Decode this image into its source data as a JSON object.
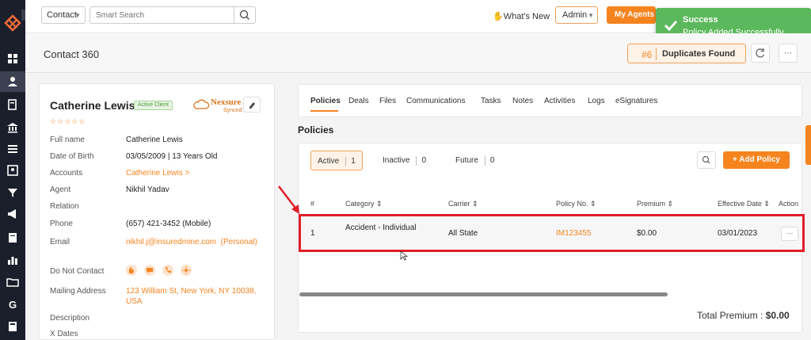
{
  "topbar": {
    "contact_select": "Contact",
    "search_placeholder": "Smart Search",
    "whats_new": "What's New",
    "admin_select": "Admin",
    "my_agents": "My Agents"
  },
  "toast": {
    "title": "Success",
    "message": "Policy Added Successfully."
  },
  "header": {
    "title": "Contact 360",
    "duplicates_count": "#6",
    "duplicates_label": "Duplicates Found",
    "more": "···"
  },
  "contact": {
    "name": "Catherine Lewis",
    "badge": "Active Client",
    "stars": "☆☆☆☆☆",
    "integration_name": "Nexsure",
    "integration_status": "Synced",
    "fields": {
      "full_name_label": "Full name",
      "full_name": "Catherine Lewis",
      "dob_label": "Date of Birth",
      "dob": "03/05/2009",
      "age": "13 Years Old",
      "accounts_label": "Accounts",
      "accounts": "Catherine Lewis >",
      "agent_label": "Agent",
      "agent": "Nikhil Yadav",
      "relation_label": "Relation",
      "phone_label": "Phone",
      "phone": "(657) 421-3452 (Mobile)",
      "email_label": "Email",
      "email": "nikhil.j@insuredmine.com",
      "email_type": "(Personal)",
      "dnc_label": "Do Not Contact",
      "mailing_label": "Mailing Address",
      "mailing_line1": "123 William St, New York, NY 10038,",
      "mailing_line2": "USA",
      "description_label": "Description",
      "xdates_label": "X Dates"
    }
  },
  "tabs": [
    "Policies",
    "Deals",
    "Files",
    "Communications",
    "Tasks",
    "Notes",
    "Activities",
    "Logs",
    "eSignatures"
  ],
  "policies": {
    "section_title": "Policies",
    "filters": [
      {
        "label": "Active",
        "count": "1"
      },
      {
        "label": "Inactive",
        "count": "0"
      },
      {
        "label": "Future",
        "count": "0"
      }
    ],
    "add_button": "+ Add Policy",
    "columns": [
      "#",
      "Category",
      "Carrier",
      "Policy No.",
      "Premium",
      "Effective Date",
      "Action"
    ],
    "rows": [
      {
        "num": "1",
        "category": "Accident - Individual",
        "carrier": "All State",
        "policy_no": "IM123455",
        "premium": "$0.00",
        "effective_date": "03/01/2023"
      }
    ],
    "total_label": "Total Premium :",
    "total_value": "$0.00"
  },
  "colors": {
    "accent": "#f5841f",
    "success": "#5cb85c",
    "highlight": "#e01e2a",
    "sidebar": "#1b1f2b"
  }
}
